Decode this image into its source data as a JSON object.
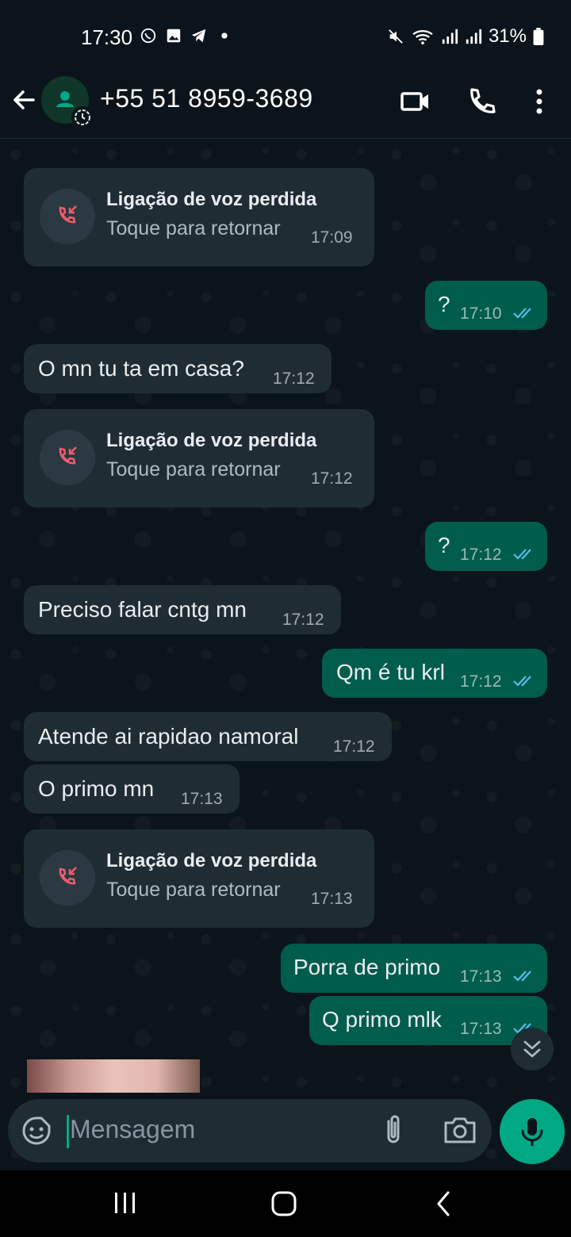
{
  "status_bar": {
    "time": "17:30",
    "battery": "31%",
    "left_icons": [
      "whatsapp-icon",
      "gallery-icon",
      "telegram-icon",
      "dot-icon"
    ],
    "right_icons": [
      "mute-icon",
      "wifi-icon",
      "signal-icon",
      "signal-icon",
      "battery-icon"
    ]
  },
  "header": {
    "contact": "+55 51 8959-3689"
  },
  "messages": [
    {
      "type": "missed_call",
      "title": "Ligação de voz perdida",
      "subtitle": "Toque para retornar",
      "time": "17:09"
    },
    {
      "type": "outgoing",
      "text": "?",
      "time": "17:10",
      "read": true
    },
    {
      "type": "incoming",
      "text": "O mn tu ta em casa?",
      "time": "17:12"
    },
    {
      "type": "missed_call",
      "title": "Ligação de voz perdida",
      "subtitle": "Toque para retornar",
      "time": "17:12"
    },
    {
      "type": "outgoing",
      "text": "?",
      "time": "17:12",
      "read": true
    },
    {
      "type": "incoming",
      "text": "Preciso falar cntg mn",
      "time": "17:12"
    },
    {
      "type": "outgoing",
      "text": "Qm é tu krl",
      "time": "17:12",
      "read": true
    },
    {
      "type": "incoming",
      "text": "Atende ai rapidao namoral",
      "time": "17:12"
    },
    {
      "type": "incoming",
      "text": "O primo mn",
      "time": "17:13"
    },
    {
      "type": "missed_call",
      "title": "Ligação de voz perdida",
      "subtitle": "Toque para retornar",
      "time": "17:13"
    },
    {
      "type": "outgoing",
      "text": "Porra de primo",
      "time": "17:13",
      "read": true
    },
    {
      "type": "outgoing",
      "text": "Q primo mlk",
      "time": "17:13",
      "read": true
    }
  ],
  "composer": {
    "placeholder": "Mensagem"
  },
  "colors": {
    "accent": "#00a884",
    "outgoing_bubble": "#005c4b",
    "incoming_bubble": "#202c33",
    "missed_call_red": "#f15c6d",
    "read_tick": "#53bdeb"
  }
}
